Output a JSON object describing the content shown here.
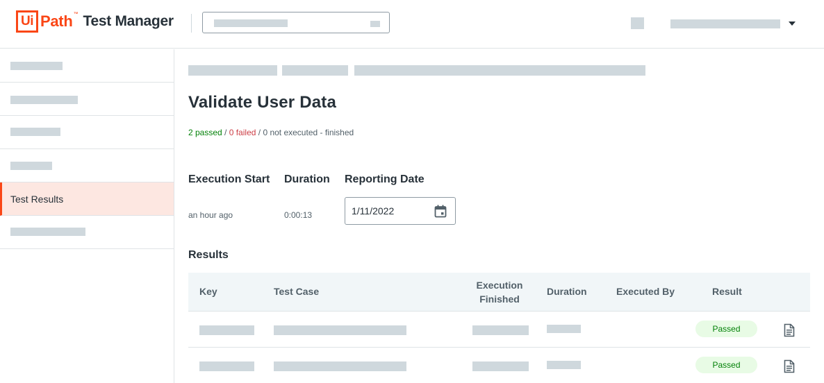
{
  "header": {
    "logo_ui": "Ui",
    "logo_path": "Path",
    "logo_tm": "™",
    "product": "Test Manager"
  },
  "sidebar": {
    "active_item_label": "Test Results"
  },
  "page": {
    "title": "Validate User Data",
    "summary": {
      "passed": "2 passed",
      "sep1": " / ",
      "failed": "0 failed",
      "sep2": " / ",
      "rest": "0 not executed - finished"
    }
  },
  "fields": {
    "execution_start_label": "Execution Start",
    "execution_start_value": "an hour ago",
    "duration_label": "Duration",
    "duration_value": "0:00:13",
    "reporting_date_label": "Reporting Date",
    "reporting_date_value": "1/11/2022"
  },
  "results": {
    "label": "Results",
    "columns": {
      "key": "Key",
      "test_case": "Test Case",
      "execution_finished_1": "Execution",
      "execution_finished_2": "Finished",
      "duration": "Duration",
      "executed_by": "Executed By",
      "result": "Result"
    },
    "rows": [
      {
        "result": "Passed"
      },
      {
        "result": "Passed"
      }
    ]
  },
  "colors": {
    "brand": "#fa4616",
    "passed": "#038108",
    "failed": "#cc3d45",
    "active_nav_bg": "#fde7e1"
  },
  "icons": [
    "calendar-icon",
    "document-icon",
    "caret-down-icon"
  ]
}
